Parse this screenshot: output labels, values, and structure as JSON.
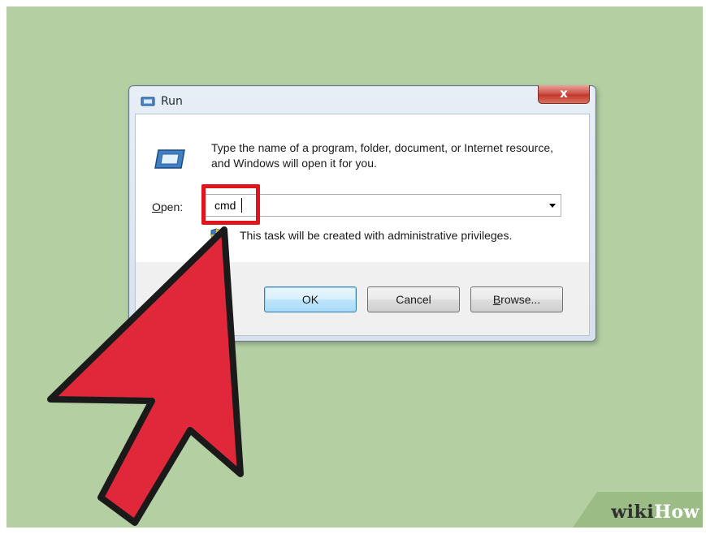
{
  "window": {
    "title": "Run",
    "close_label": "x",
    "description": "Type the name of a program, folder, document, or Internet resource, and Windows will open it for you.",
    "icon": "run-icon"
  },
  "open_field": {
    "label_underlined": "O",
    "label_rest": "pen:",
    "value": "cmd"
  },
  "admin_note": "This task will be created with administrative privileges.",
  "buttons": {
    "ok": "OK",
    "cancel": "Cancel",
    "browse_underlined": "B",
    "browse_rest": "rowse..."
  },
  "annotation": {
    "highlight_color": "#e0141c",
    "arrow_color": "#e0283a"
  },
  "watermark": {
    "wiki": "wiki",
    "how": "How"
  },
  "colors": {
    "background": "#b4cfa2",
    "ok_button_accent": "#3c7fb1"
  }
}
